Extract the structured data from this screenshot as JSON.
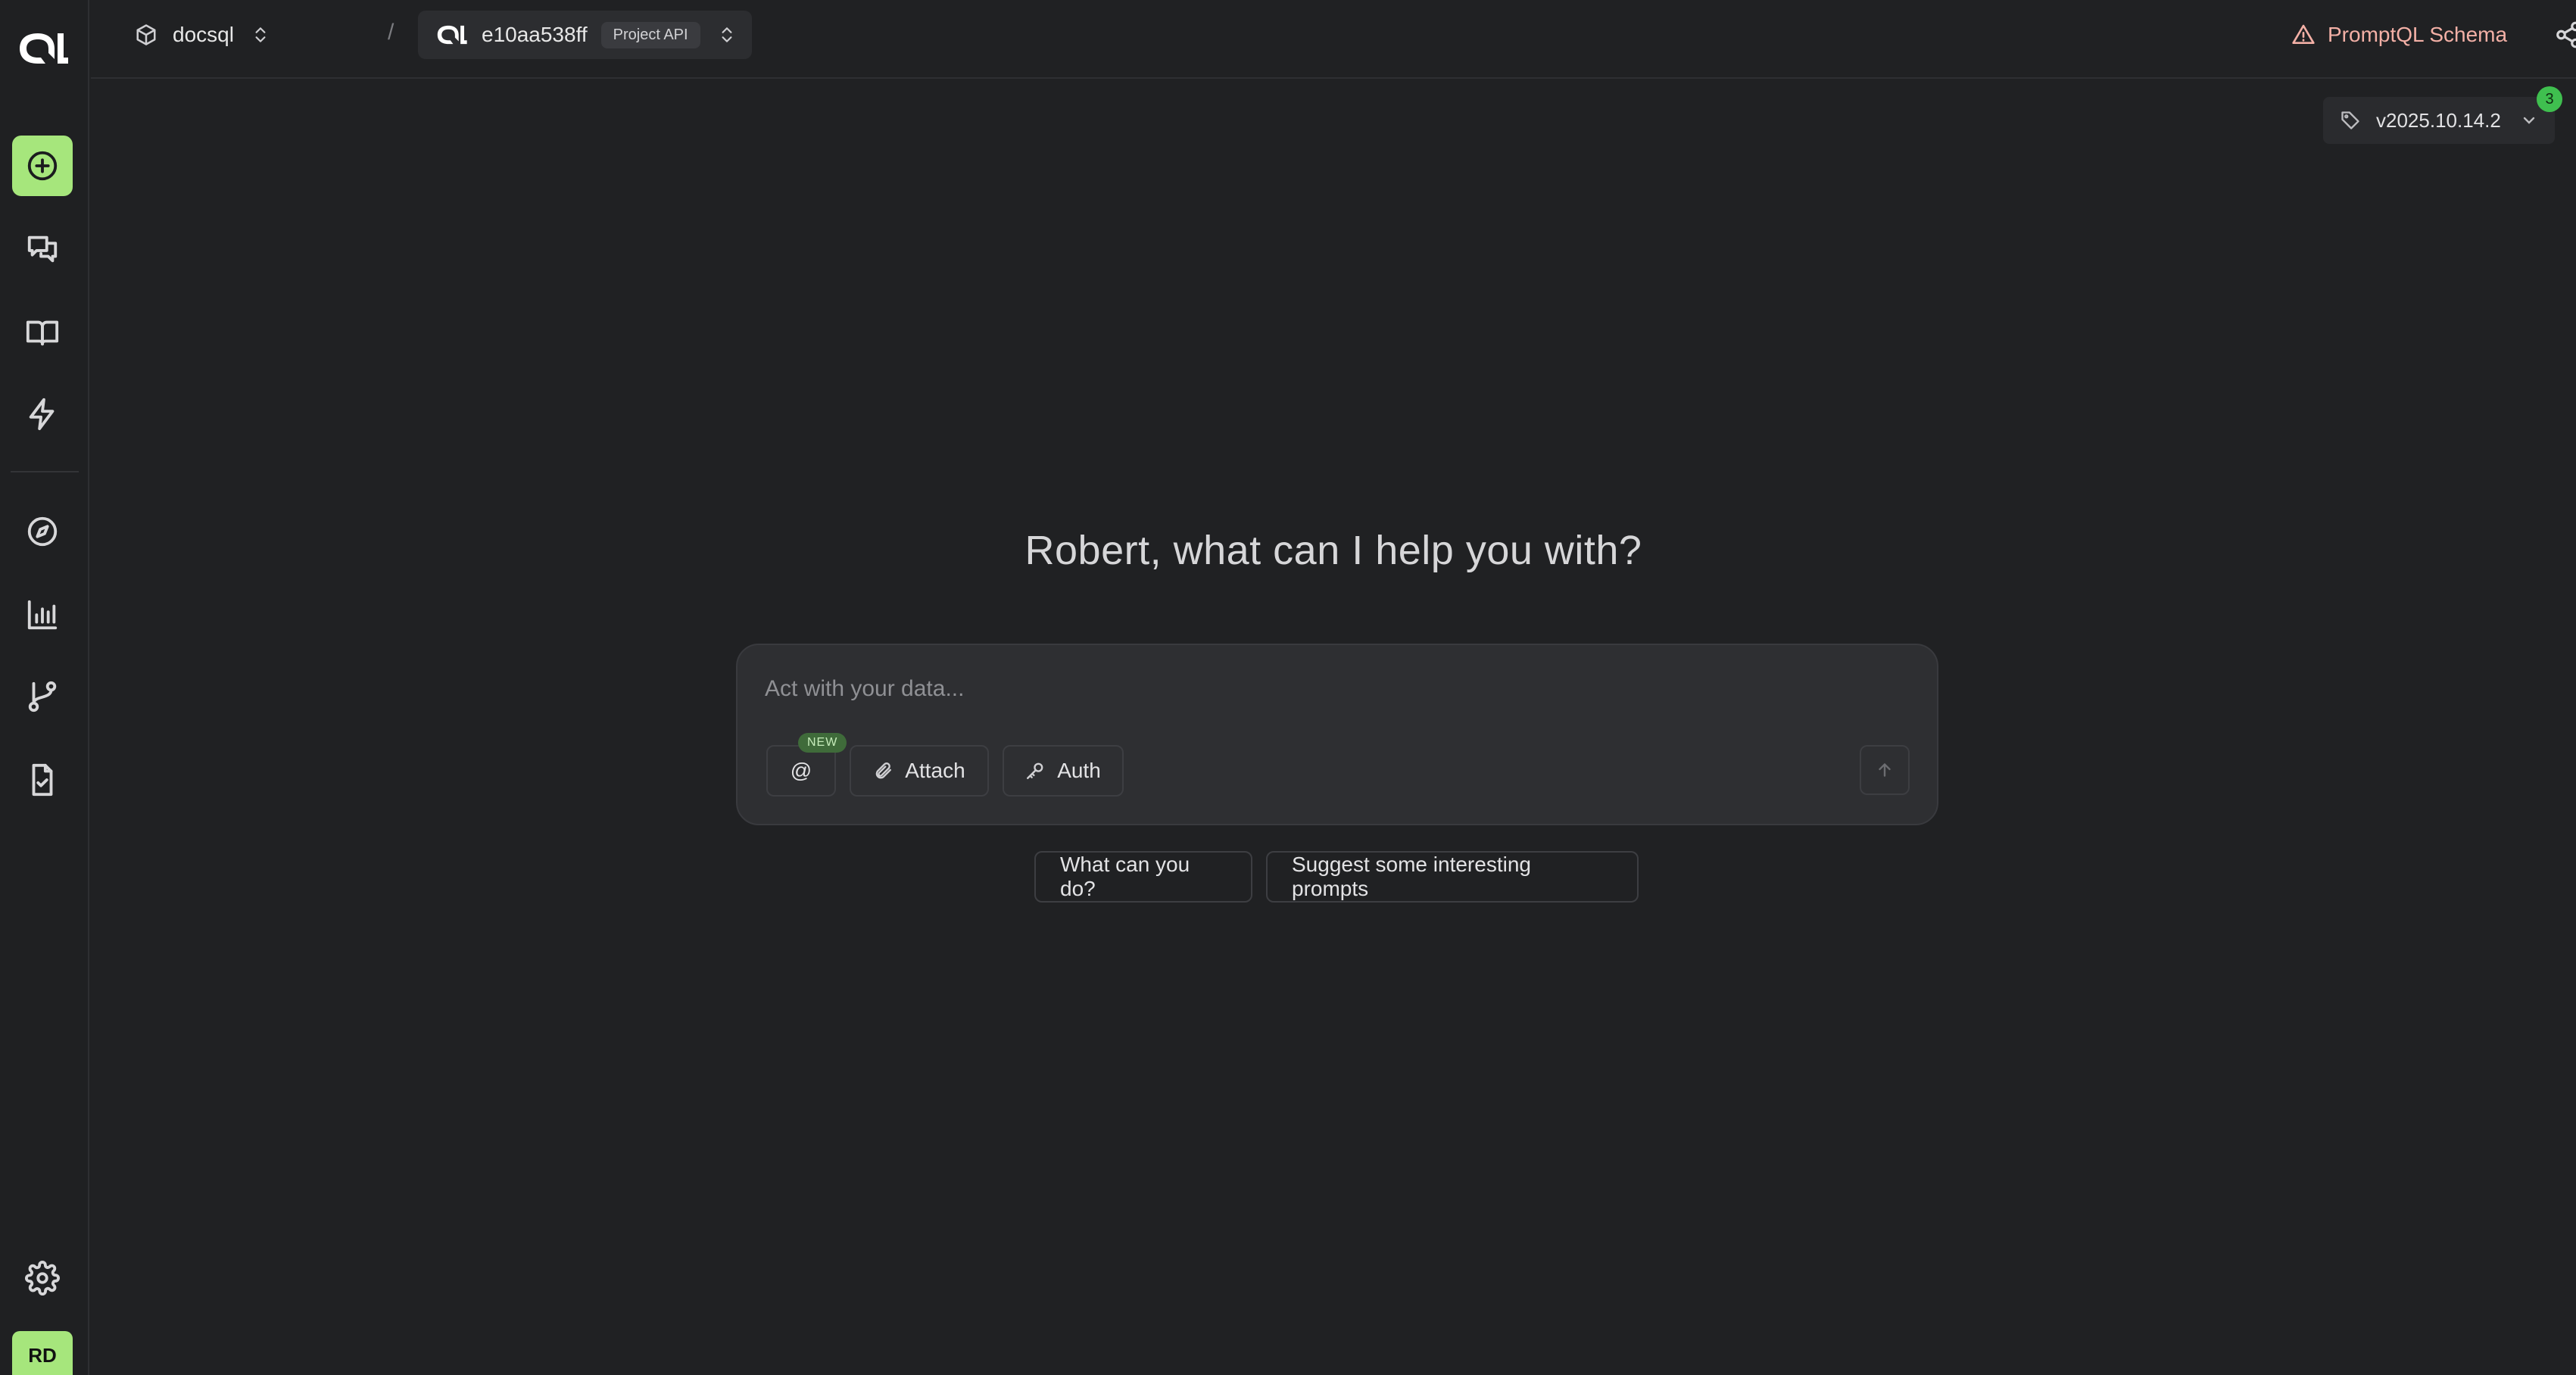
{
  "sidebar": {
    "logo_text": "QL",
    "items": [
      {
        "name": "new-thread",
        "icon": "plus-circle-icon"
      },
      {
        "name": "threads",
        "icon": "chat-bubbles-icon"
      },
      {
        "name": "wiki",
        "icon": "book-open-icon"
      },
      {
        "name": "automations",
        "icon": "lightning-icon"
      },
      {
        "name": "explore",
        "icon": "compass-icon"
      },
      {
        "name": "analytics",
        "icon": "bar-chart-icon"
      },
      {
        "name": "branches",
        "icon": "git-branch-icon"
      },
      {
        "name": "evaluations",
        "icon": "file-check-icon"
      },
      {
        "name": "settings",
        "icon": "gear-icon"
      }
    ],
    "avatar_initials": "RD"
  },
  "topbar": {
    "org_name": "docsql",
    "separator": "/",
    "project_id": "e10aa538ff",
    "project_badge": "Project API",
    "schema_warning": "PromptQL Schema"
  },
  "version": {
    "label": "v2025.10.14.2",
    "badge_count": "3"
  },
  "main": {
    "greeting": "Robert, what can I help you with?",
    "composer": {
      "placeholder": "Act with your data...",
      "mention_label": "@",
      "new_badge": "NEW",
      "attach_label": "Attach",
      "auth_label": "Auth"
    },
    "suggestions": [
      "What can you do?",
      "Suggest some interesting prompts"
    ]
  },
  "colors": {
    "background": "#202123",
    "accent_green": "#a6e67c",
    "warning": "#f3b0a6",
    "badge_green": "#3fbf4f"
  }
}
